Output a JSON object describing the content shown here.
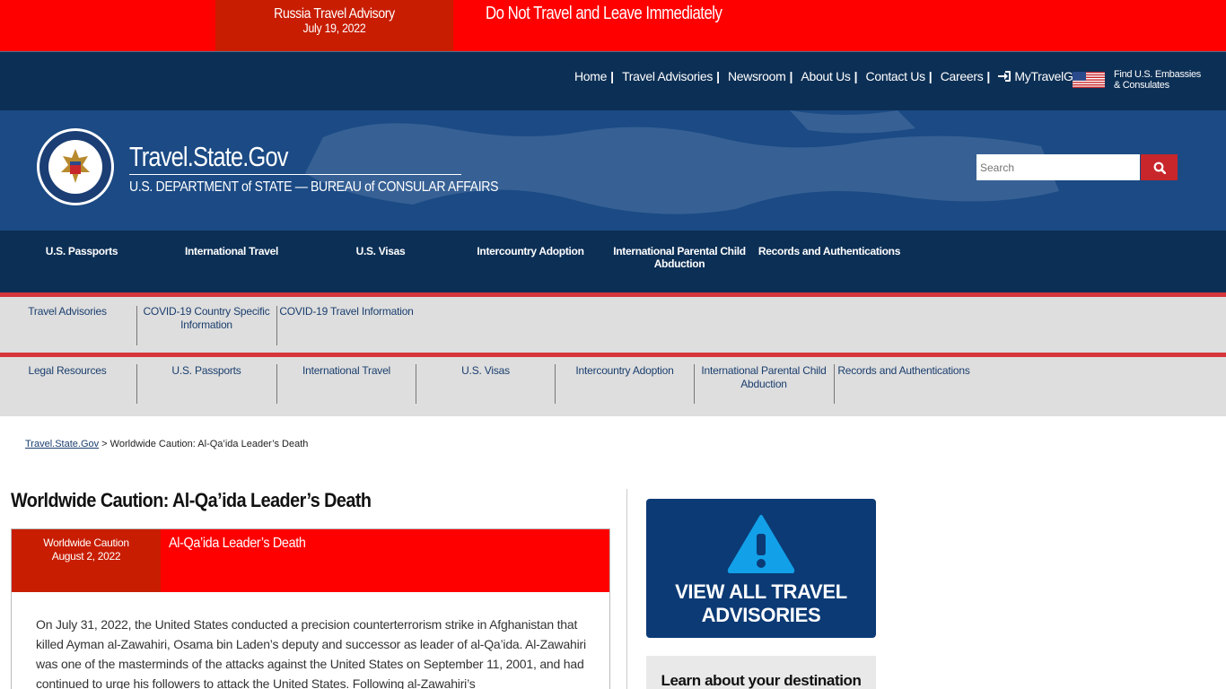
{
  "alert": {
    "name": "Russia Travel Advisory",
    "date": "July 19, 2022",
    "message": "Do Not Travel and Leave Immediately"
  },
  "utility_nav": {
    "items": [
      "Home",
      "Travel Advisories",
      "Newsroom",
      "About Us",
      "Contact Us",
      "Careers",
      "MyTravelGov"
    ],
    "embassy_line1": "Find U.S. Embassies",
    "embassy_line2": "& Consulates"
  },
  "header": {
    "title": "Travel.State.Gov",
    "subtitle": "U.S. DEPARTMENT of STATE — BUREAU of CONSULAR AFFAIRS",
    "search_placeholder": "Search"
  },
  "main_nav": {
    "items": [
      "U.S. Passports",
      "International Travel",
      "U.S. Visas",
      "Intercountry Adoption",
      "International Parental Child Abduction",
      "Records and Authentications"
    ]
  },
  "sub_nav_1": {
    "items": [
      "Travel Advisories",
      "COVID-19 Country Specific Information",
      "COVID-19 Travel Information"
    ]
  },
  "sub_nav_2": {
    "items": [
      "Legal Resources",
      "U.S. Passports",
      "International Travel",
      "U.S. Visas",
      "Intercountry Adoption",
      "International Parental Child Abduction",
      "Records and Authentications"
    ]
  },
  "breadcrumb": {
    "home": "Travel.State.Gov",
    "separator": " > ",
    "current": "Worldwide Caution: Al-Qa’ida Leader’s Death"
  },
  "page": {
    "title": "Worldwide Caution: Al-Qa’ida Leader’s Death",
    "tag_line1": "Worldwide Caution",
    "tag_line2": "August 2, 2022",
    "card_title": "Al-Qa’ida Leader’s Death",
    "body": "On July 31, 2022, the United States conducted a precision counterterrorism strike in Afghanistan that killed Ayman al-Zawahiri, Osama bin Laden’s deputy and successor as leader of al-Qa’ida. Al-Zawahiri was one of the masterminds of the attacks against the United States on September 11, 2001, and had continued to urge his followers to attack the United States. Following al-Zawahiri’s"
  },
  "sidebar": {
    "advisories_button": "VIEW ALL TRAVEL ADVISORIES",
    "learn_label": "Learn about your destination"
  },
  "colors": {
    "alert_red": "#ff0000",
    "alert_dark_red": "#c81d00",
    "navy": "#0c2f55",
    "header_blue": "#1b4a84",
    "subnav_gray": "#dedede",
    "search_red": "#c8262b"
  }
}
